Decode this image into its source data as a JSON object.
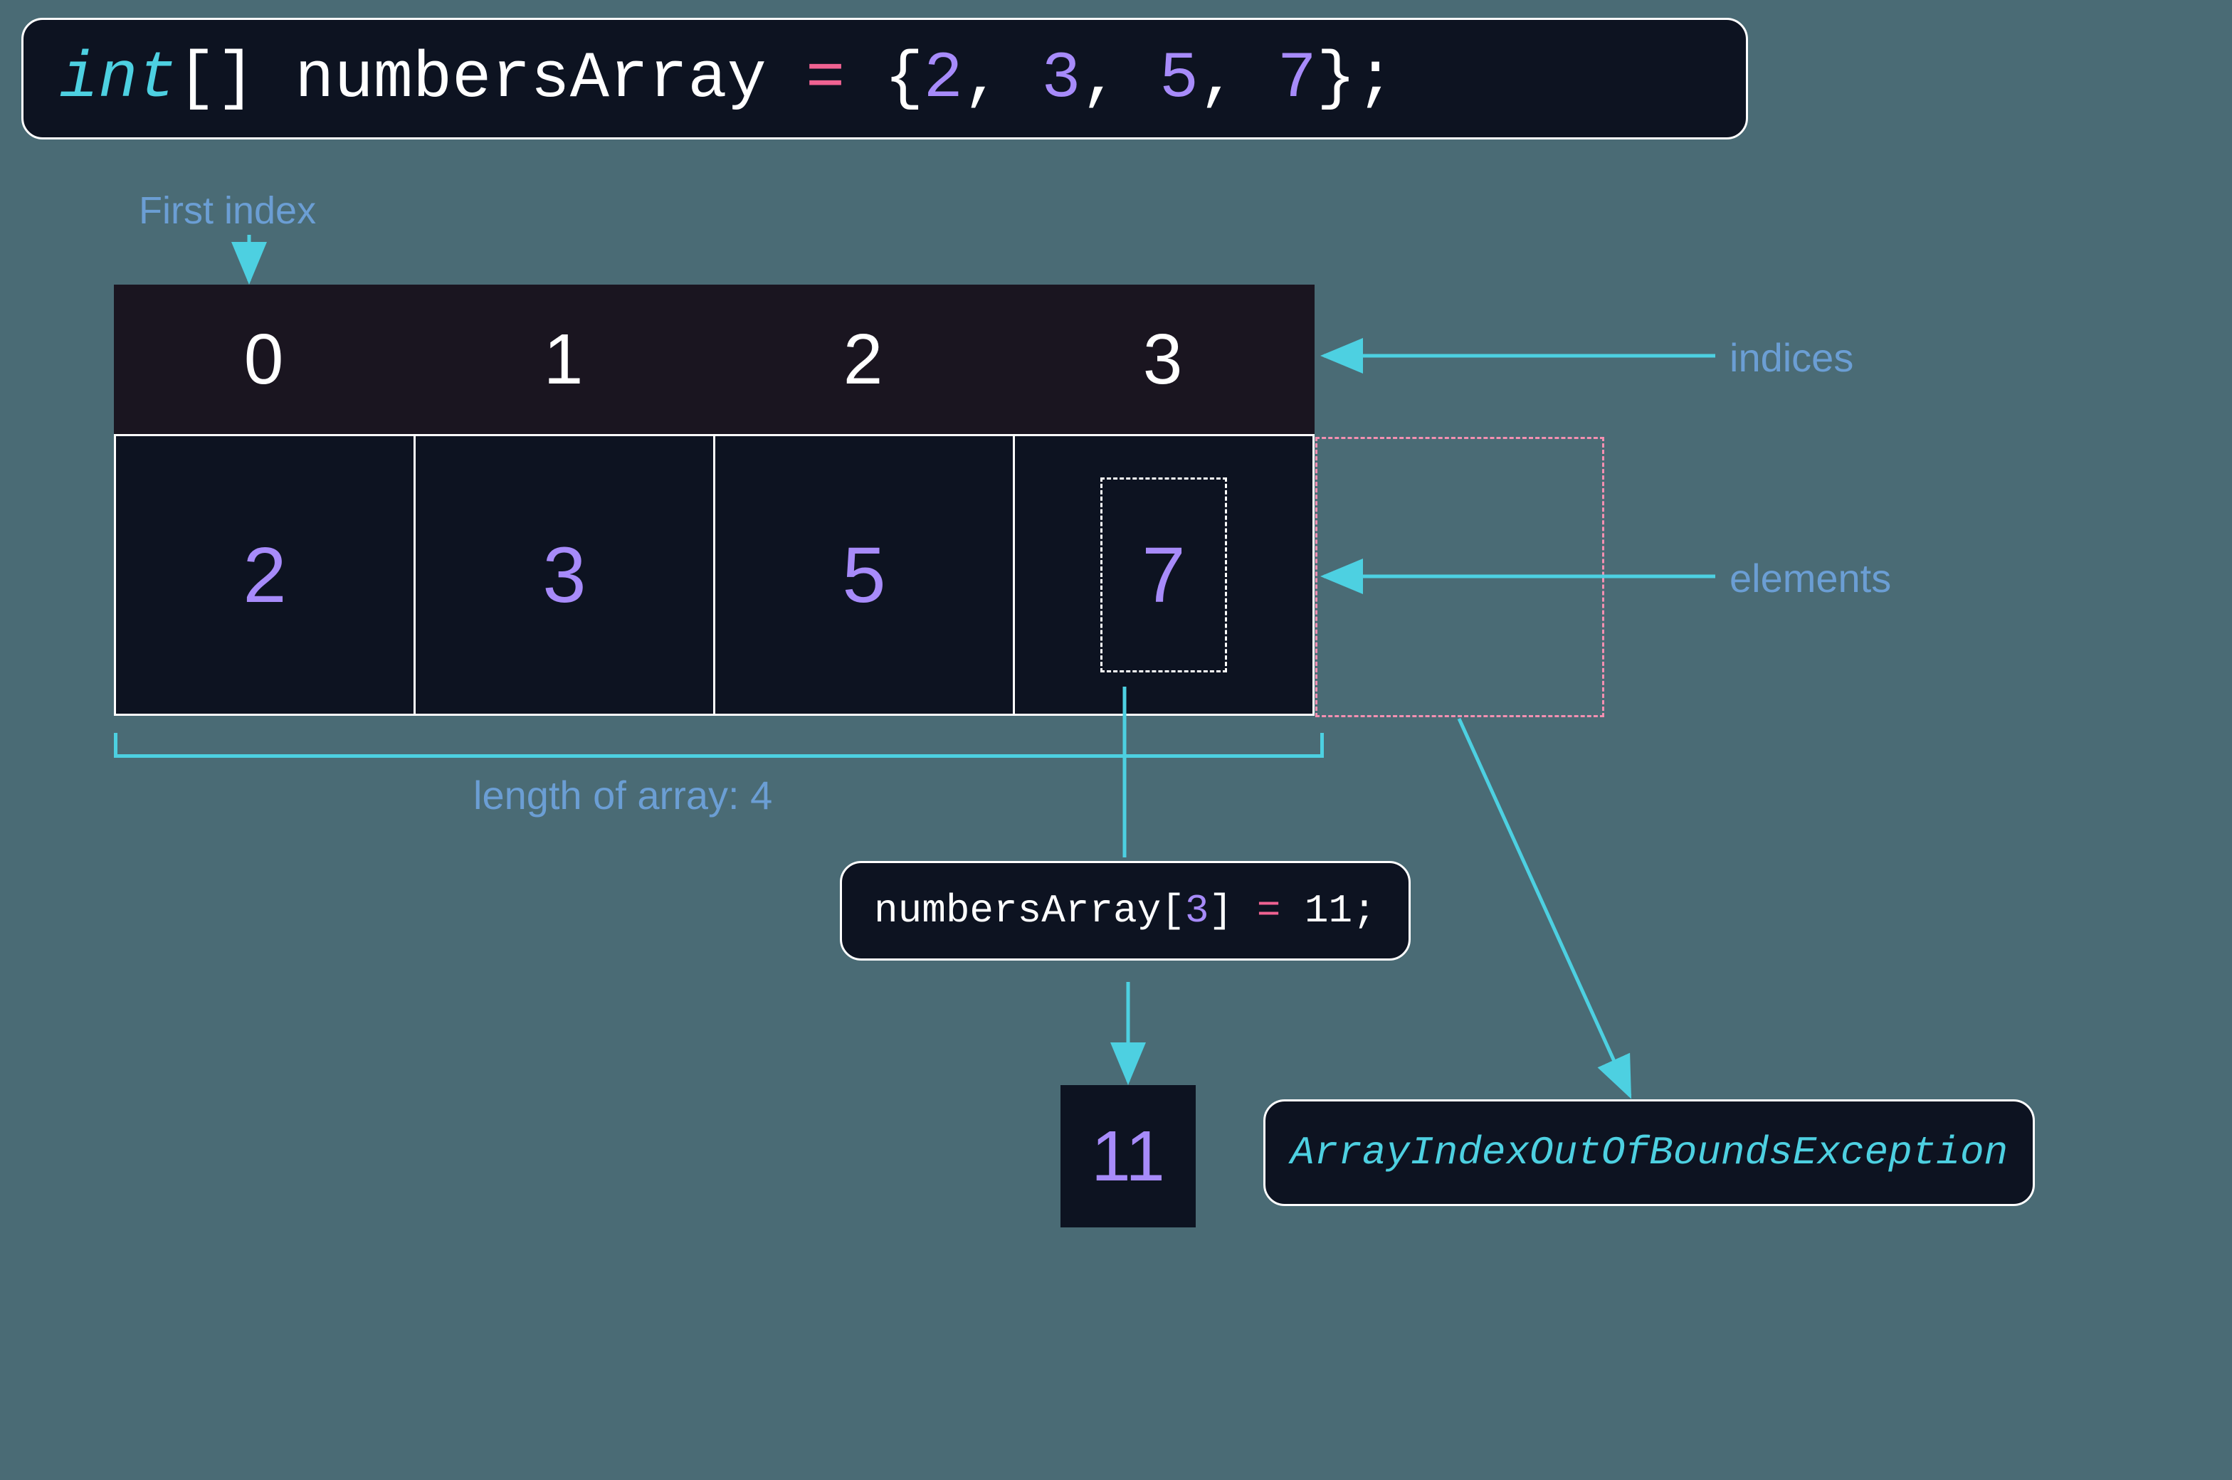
{
  "declaration": {
    "type": "int",
    "brackets": "[]",
    "name": " numbersArray ",
    "equals": "=",
    "open": " {",
    "values": [
      "2",
      "3",
      "5",
      "7"
    ],
    "close": "};"
  },
  "labels": {
    "firstIndex": "First index",
    "indices": "indices",
    "elements": "elements",
    "length": "length of array: 4",
    "exception": "ArrayIndexOutOfBoundsException"
  },
  "indices": [
    "0",
    "1",
    "2",
    "3"
  ],
  "elements": [
    "2",
    "3",
    "5",
    "7"
  ],
  "assignment": {
    "name": "numbersArray[",
    "index": "3",
    "close": "] ",
    "equals": "=",
    "value": " 11",
    "semi": ";"
  },
  "newValue": "11",
  "chart_data": {
    "type": "table",
    "title": "Java array declaration and indexing diagram",
    "array_name": "numbersArray",
    "array_type": "int[]",
    "indices": [
      0,
      1,
      2,
      3
    ],
    "elements": [
      2,
      3,
      5,
      7
    ],
    "length": 4,
    "assignment": {
      "index": 3,
      "new_value": 11
    },
    "out_of_bounds_hint": "ArrayIndexOutOfBoundsException"
  }
}
